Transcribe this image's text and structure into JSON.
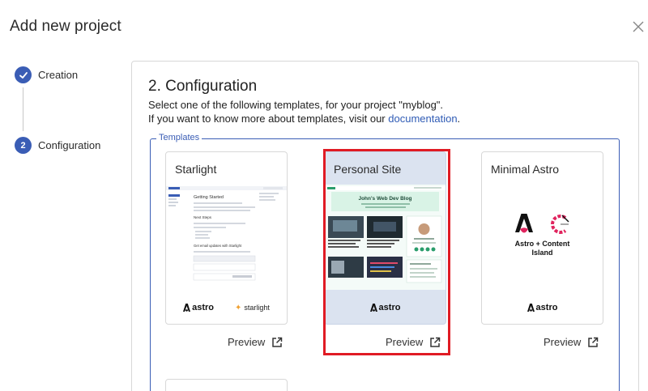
{
  "dialog": {
    "title": "Add new project",
    "close_label": "×"
  },
  "steps": [
    {
      "number": "✓",
      "label": "Creation",
      "status": "completed"
    },
    {
      "number": "2",
      "label": "Configuration",
      "status": "active"
    }
  ],
  "configuration": {
    "title": "2. Configuration",
    "line1": "Select one of the following templates, for your project \"myblog\".",
    "line2_prefix": "If you want to know more about templates, visit our ",
    "link_text": "documentation",
    "line2_suffix": ".",
    "fieldset_legend": "Templates"
  },
  "templates": [
    {
      "title": "Starlight",
      "logos": [
        "astro",
        "starlight"
      ],
      "preview_label": "Preview",
      "thumb": {
        "heading": "Getting Started",
        "subheading1": "Next Steps",
        "subheading2": "Get email updates with Starlight"
      }
    },
    {
      "title": "Personal Site",
      "logos": [
        "astro"
      ],
      "preview_label": "Preview",
      "selected": true,
      "thumb": {
        "heading": "John's Web Dev Blog",
        "post1": "Performance Optimization in Websites",
        "post2": "Modern CSS Techniques"
      }
    },
    {
      "title": "Minimal Astro",
      "logos": [
        "astro"
      ],
      "preview_label": "Preview",
      "center_text_1": "Astro",
      "center_plus": "+",
      "center_text_2": "Content",
      "center_text_3": "Island"
    }
  ],
  "logo_text": {
    "astro": "astro",
    "starlight": "starlight"
  },
  "colors": {
    "accent": "#3a5db5",
    "link": "#2f5bb5",
    "highlight": "#e01b24",
    "selected_card_bg": "#dbe3f0"
  }
}
